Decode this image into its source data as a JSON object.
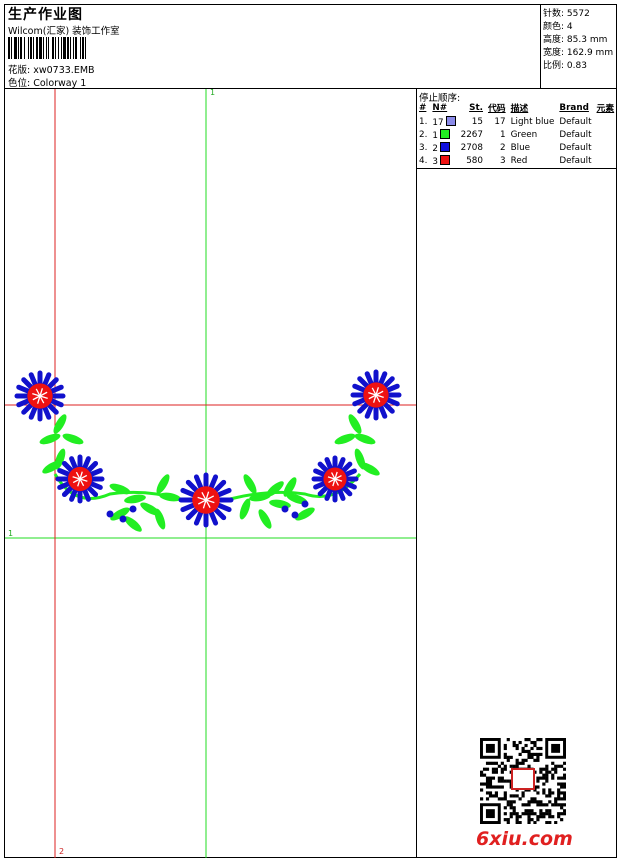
{
  "header": {
    "title": "生产作业图",
    "company": "Wilcom(汇家) 装饰工作室",
    "design_label": "花版:",
    "design_value": "xw0733.EMB",
    "color_label": "色位:",
    "color_value": "Colorway 1"
  },
  "stats": [
    {
      "label": "针数:",
      "value": "5572"
    },
    {
      "label": "颜色:",
      "value": "4"
    },
    {
      "label": "高度:",
      "value": "85.3 mm"
    },
    {
      "label": "宽度:",
      "value": "162.9 mm"
    },
    {
      "label": "比例:",
      "value": "0.83"
    }
  ],
  "stop_sequence": {
    "label": "停止顺序:",
    "columns": [
      "#",
      "N#",
      "St.",
      "代码",
      "描述",
      "Brand",
      "元素"
    ],
    "rows": [
      {
        "seq": "1.",
        "n": "17",
        "color": "#8a8ae8",
        "st": "15",
        "code": "17",
        "desc": "Light blue",
        "brand": "Default"
      },
      {
        "seq": "2.",
        "n": "1",
        "color": "#22ee22",
        "st": "2267",
        "code": "1",
        "desc": "Green",
        "brand": "Default"
      },
      {
        "seq": "3.",
        "n": "2",
        "color": "#1111dd",
        "st": "2708",
        "code": "2",
        "desc": "Blue",
        "brand": "Default"
      },
      {
        "seq": "4.",
        "n": "3",
        "color": "#ee1111",
        "st": "580",
        "code": "3",
        "desc": "Red",
        "brand": "Default"
      }
    ]
  },
  "axis_labels": {
    "top": "1",
    "left": "1",
    "bottom": "2"
  },
  "colors": {
    "guide_green": "#22dd22",
    "guide_red": "#dd2222",
    "petal_blue": "#1111cc",
    "center_red": "#ee1111",
    "leaf_green": "#22ee22"
  },
  "watermark": "6xiu.com",
  "icons": [
    "barcode-icon",
    "qr-code-icon"
  ]
}
